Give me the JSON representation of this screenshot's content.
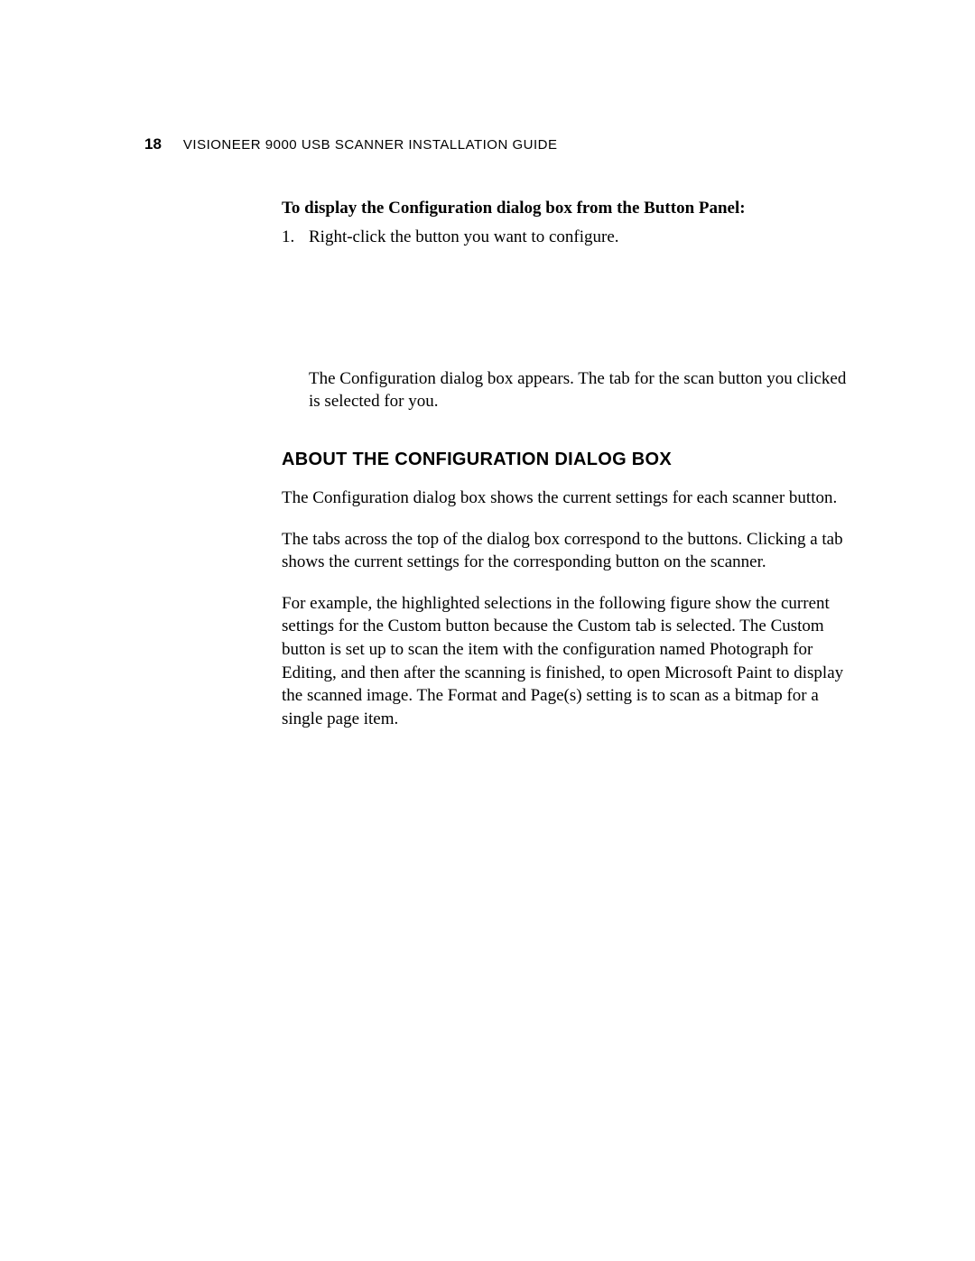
{
  "header": {
    "page_number": "18",
    "title": "VISIONEER 9000 USB SCANNER INSTALLATION GUIDE"
  },
  "content": {
    "intro_bold": "To display the Configuration dialog box from the Button Panel:",
    "step1_number": "1.",
    "step1_text": "Right-click the button you want to configure.",
    "indented_result": "The Configuration dialog box appears. The tab for the scan button you clicked is selected for you.",
    "section_heading": "ABOUT THE CONFIGURATION DIALOG BOX",
    "para1": "The Configuration dialog box shows the current settings for each scanner button.",
    "para2": "The tabs across the top of the dialog box correspond to the buttons. Clicking a tab shows the current settings for the corresponding button on the scanner.",
    "para3": "For example, the highlighted selections in the following figure show the current settings for the Custom button because the Custom tab is selected. The Custom button is set up to scan the item with the configuration named Photograph for Editing, and then after the scanning is finished, to open Microsoft Paint to display the scanned image. The Format and Page(s) setting is to scan as a bitmap for a single page item."
  }
}
